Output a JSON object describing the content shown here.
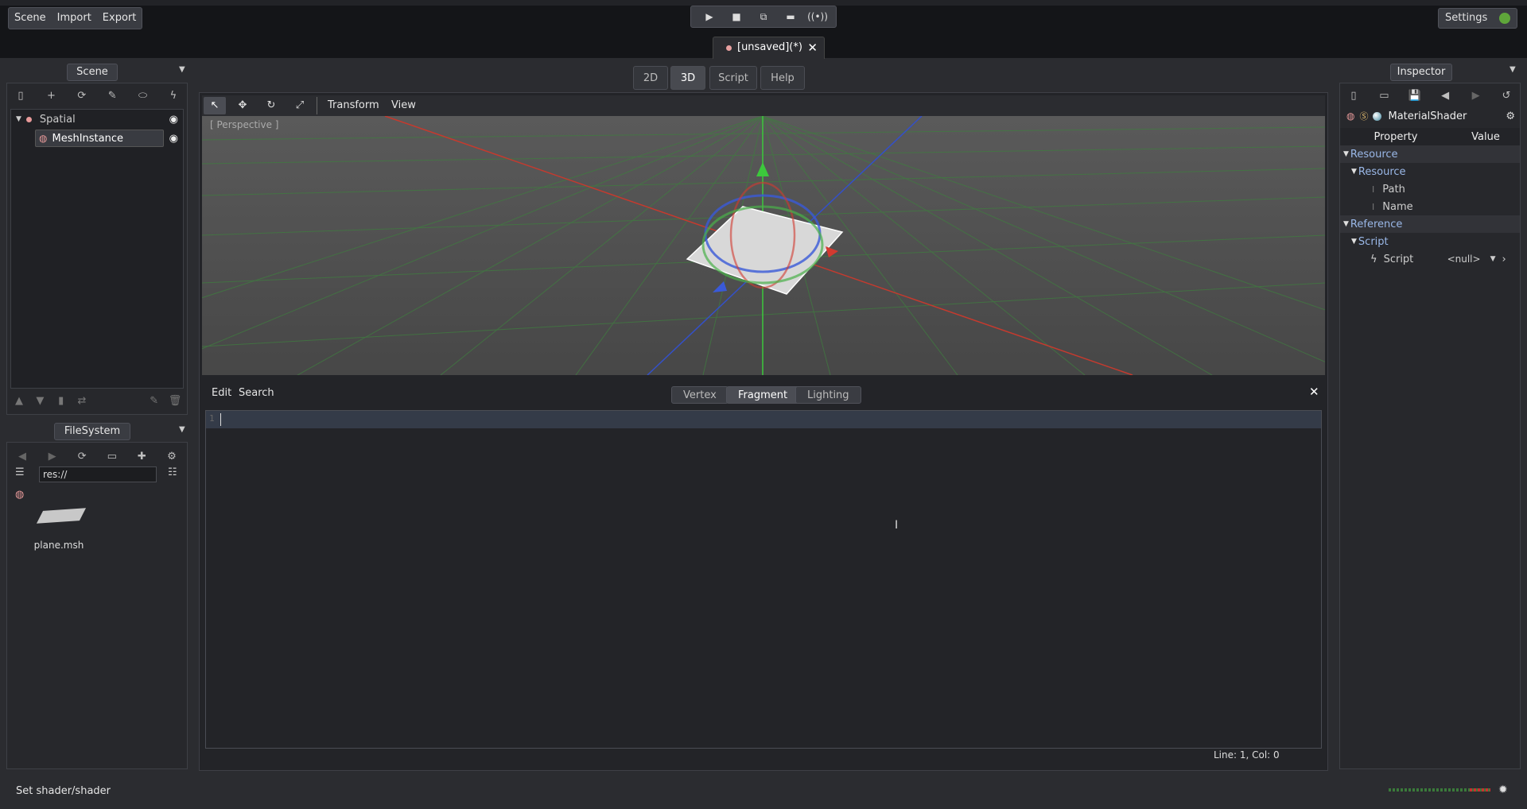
{
  "menu": {
    "scene": "Scene",
    "import": "Import",
    "export": "Export"
  },
  "settings_label": "Settings",
  "scene_tab": {
    "title": "[unsaved](*)"
  },
  "mode_tabs": [
    "2D",
    "3D",
    "Script",
    "Help"
  ],
  "scene_dock": {
    "title": "Scene",
    "nodes": [
      {
        "label": "Spatial",
        "icon": "spatial-node-icon"
      },
      {
        "label": "MeshInstance",
        "icon": "mesh-instance-icon"
      }
    ]
  },
  "filesystem_dock": {
    "title": "FileSystem",
    "path": "res://",
    "files": [
      {
        "name": "plane.msh",
        "icon": "mesh-thumbnail-icon"
      }
    ]
  },
  "viewport": {
    "toolbar": {
      "transform": "Transform",
      "view": "View"
    },
    "perspective_label": "[ Perspective ]"
  },
  "shader_editor": {
    "menu": {
      "edit": "Edit",
      "search": "Search"
    },
    "tabs": [
      "Vertex",
      "Fragment",
      "Lighting"
    ],
    "active_tab": "Fragment",
    "line_number": "1",
    "cursor_status": "Line: 1, Col: 0"
  },
  "inspector": {
    "title": "Inspector",
    "resource_type": "MaterialShader",
    "header": {
      "property": "Property",
      "value": "Value"
    },
    "sections": {
      "resource": "Resource",
      "resource_sub": "Resource",
      "path": "Path",
      "name": "Name",
      "reference": "Reference",
      "script_sub": "Script",
      "script": "Script",
      "script_value": "<null>"
    }
  },
  "status": {
    "message": "Set shader/shader"
  },
  "colors": {
    "accent": "#6b9be8",
    "x_axis": "#d23a30",
    "y_axis": "#4ab04a",
    "z_axis": "#3a5ad8"
  }
}
